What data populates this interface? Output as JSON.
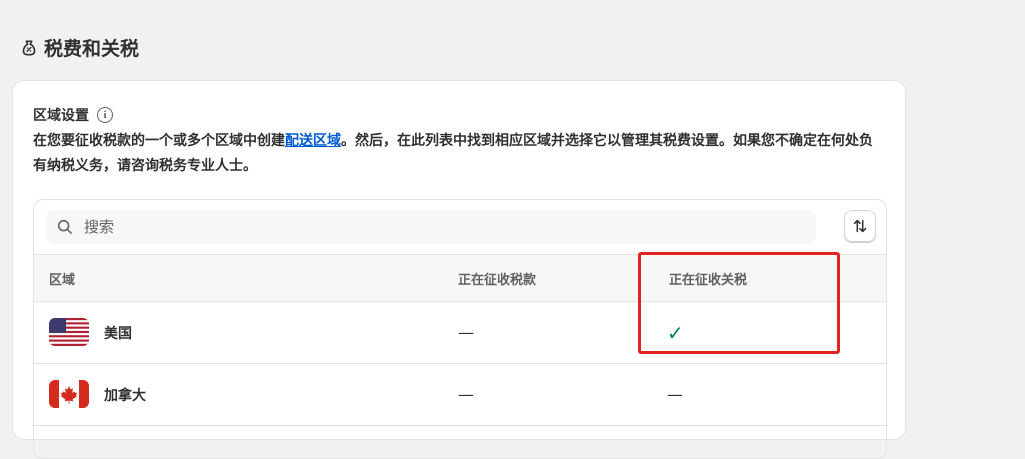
{
  "page": {
    "title": "税费和关税",
    "icon": "tax-bag-icon"
  },
  "section": {
    "title": "区域设置",
    "desc_before": "在您要征收税款的一个或多个区域中创建",
    "desc_link": "配送区域",
    "desc_after": "。然后，在此列表中找到相应区域并选择它以管理其税费设置。如果您不确定在何处负有纳税义务，请咨询税务专业人士。"
  },
  "search": {
    "placeholder": "搜索"
  },
  "table": {
    "headers": {
      "region": "区域",
      "tax": "正在征收税款",
      "duty": "正在征收关税"
    },
    "rows": [
      {
        "flag": "us-flag",
        "name": "美国",
        "tax": "—",
        "duty": "✓",
        "duty_status": "check"
      },
      {
        "flag": "ca-flag",
        "name": "加拿大",
        "tax": "—",
        "duty": "—",
        "duty_status": "dash"
      }
    ]
  },
  "colors": {
    "accent_link": "#005bd3",
    "check": "#0a7f55",
    "highlight": "#e02424"
  }
}
